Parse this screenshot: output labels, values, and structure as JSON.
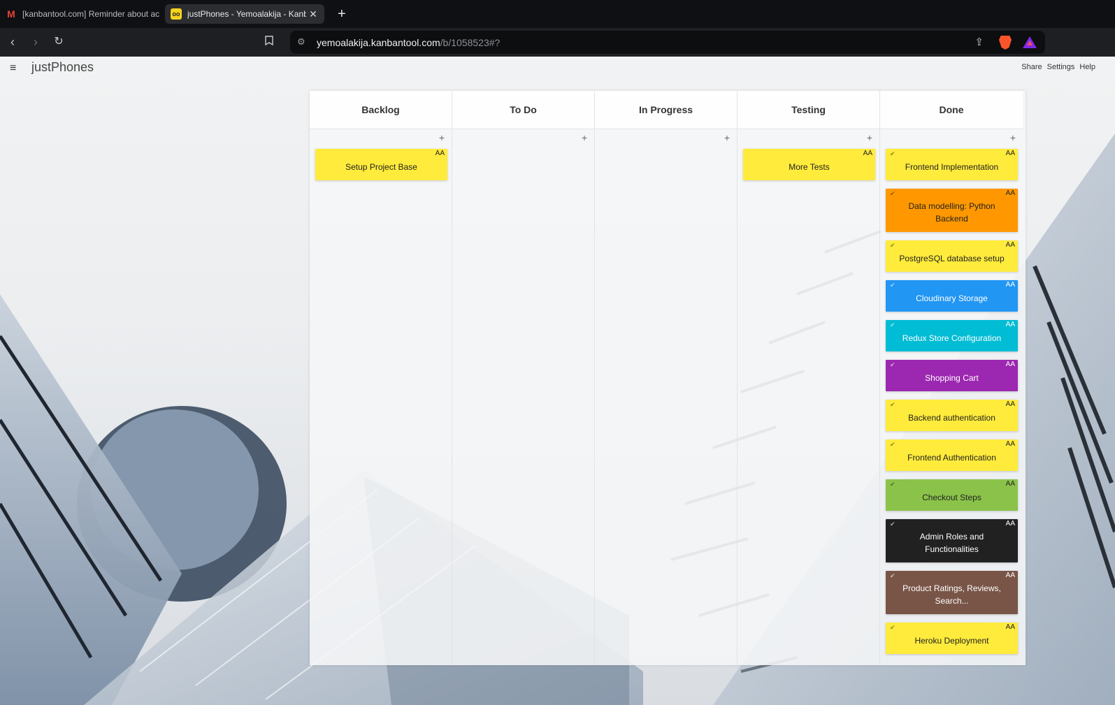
{
  "browser": {
    "tabs": [
      {
        "title": "[kanbantool.com] Reminder about ac",
        "icon": "gmail-icon"
      },
      {
        "title": "justPhones - Yemoalakija - Kanb",
        "icon": "kanbantool-icon"
      }
    ],
    "url_host": "yemoalakija.kanbantool.com",
    "url_path": "/b/1058523#?"
  },
  "app": {
    "title": "justPhones",
    "links": [
      "Share",
      "Settings",
      "Help"
    ]
  },
  "board": {
    "columns": [
      {
        "name": "Backlog",
        "cards": [
          {
            "title": "Setup Project Base",
            "initials": "AA",
            "color": "#ffeb3b",
            "done": false
          }
        ]
      },
      {
        "name": "To Do",
        "cards": []
      },
      {
        "name": "In Progress",
        "cards": []
      },
      {
        "name": "Testing",
        "cards": [
          {
            "title": "More Tests",
            "initials": "AA",
            "color": "#ffeb3b",
            "done": false
          }
        ]
      },
      {
        "name": "Done",
        "cards": [
          {
            "title": "Frontend Implementation",
            "initials": "AA",
            "color": "#ffeb3b",
            "done": true
          },
          {
            "title": "Data modelling: Python Backend",
            "initials": "AA",
            "color": "#ff9800",
            "done": true
          },
          {
            "title": "PostgreSQL database setup",
            "initials": "AA",
            "color": "#ffeb3b",
            "done": true
          },
          {
            "title": "Cloudinary Storage",
            "initials": "AA",
            "color": "#2196f3",
            "done": true
          },
          {
            "title": "Redux Store Configuration",
            "initials": "AA",
            "color": "#00bcd4",
            "done": true
          },
          {
            "title": "Shopping Cart",
            "initials": "AA",
            "color": "#9c27b0",
            "done": true
          },
          {
            "title": "Backend authentication",
            "initials": "AA",
            "color": "#ffeb3b",
            "done": true
          },
          {
            "title": "Frontend Authentication",
            "initials": "AA",
            "color": "#ffeb3b",
            "done": true
          },
          {
            "title": "Checkout Steps",
            "initials": "AA",
            "color": "#8bc34a",
            "done": true
          },
          {
            "title": "Admin Roles and Functionalities",
            "initials": "AA",
            "color": "#212121",
            "done": true
          },
          {
            "title": "Product Ratings, Reviews, Search...",
            "initials": "AA",
            "color": "#795548",
            "done": true
          },
          {
            "title": "Heroku Deployment",
            "initials": "AA",
            "color": "#ffeb3b",
            "done": true
          }
        ]
      }
    ]
  }
}
